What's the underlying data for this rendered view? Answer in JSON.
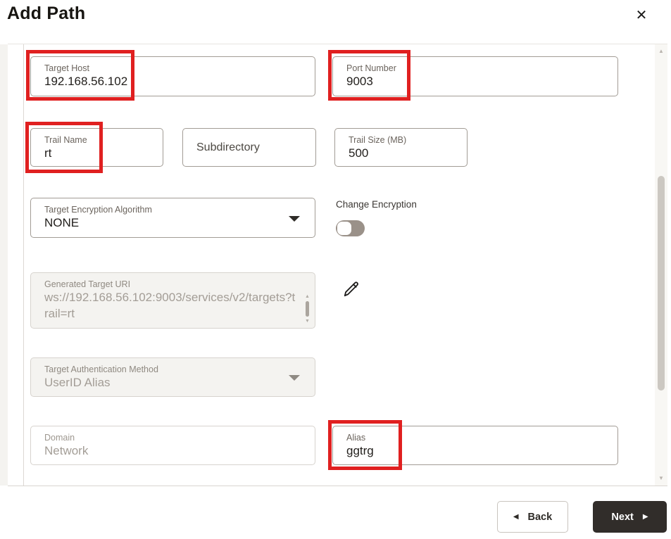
{
  "dialog": {
    "title": "Add Path"
  },
  "icons": {
    "close": "✕",
    "back_arrow": "◀",
    "next_arrow": "▶",
    "scroll_up": "▲",
    "scroll_down": "▼",
    "dropdown_caret": "triangle-down",
    "edit": "pencil"
  },
  "fields": {
    "target_host": {
      "label": "Target Host",
      "value": "192.168.56.102"
    },
    "port_number": {
      "label": "Port Number",
      "value": "9003"
    },
    "trail_name": {
      "label": "Trail Name",
      "value": "rt"
    },
    "subdirectory": {
      "label": "Subdirectory",
      "value": ""
    },
    "trail_size": {
      "label": "Trail Size (MB)",
      "value": "500"
    },
    "target_encryption_algorithm": {
      "label": "Target Encryption Algorithm",
      "value": "NONE"
    },
    "change_encryption": {
      "label": "Change Encryption",
      "state": "off"
    },
    "generated_target_uri": {
      "label": "Generated Target URI",
      "value": "ws://192.168.56.102:9003/services/v2/targets?trail=rt",
      "disabled": true
    },
    "target_authentication_method": {
      "label": "Target Authentication Method",
      "value": "UserID Alias",
      "disabled": true
    },
    "domain": {
      "label": "Domain",
      "value": "Network"
    },
    "alias": {
      "label": "Alias",
      "value": "ggtrg"
    }
  },
  "footer": {
    "back_label": "Back",
    "next_label": "Next"
  },
  "colors": {
    "highlight_red": "#e02020",
    "primary_button": "#312d2a",
    "toggle_off": "#9a9189",
    "disabled_bg": "#f4f3f0"
  }
}
